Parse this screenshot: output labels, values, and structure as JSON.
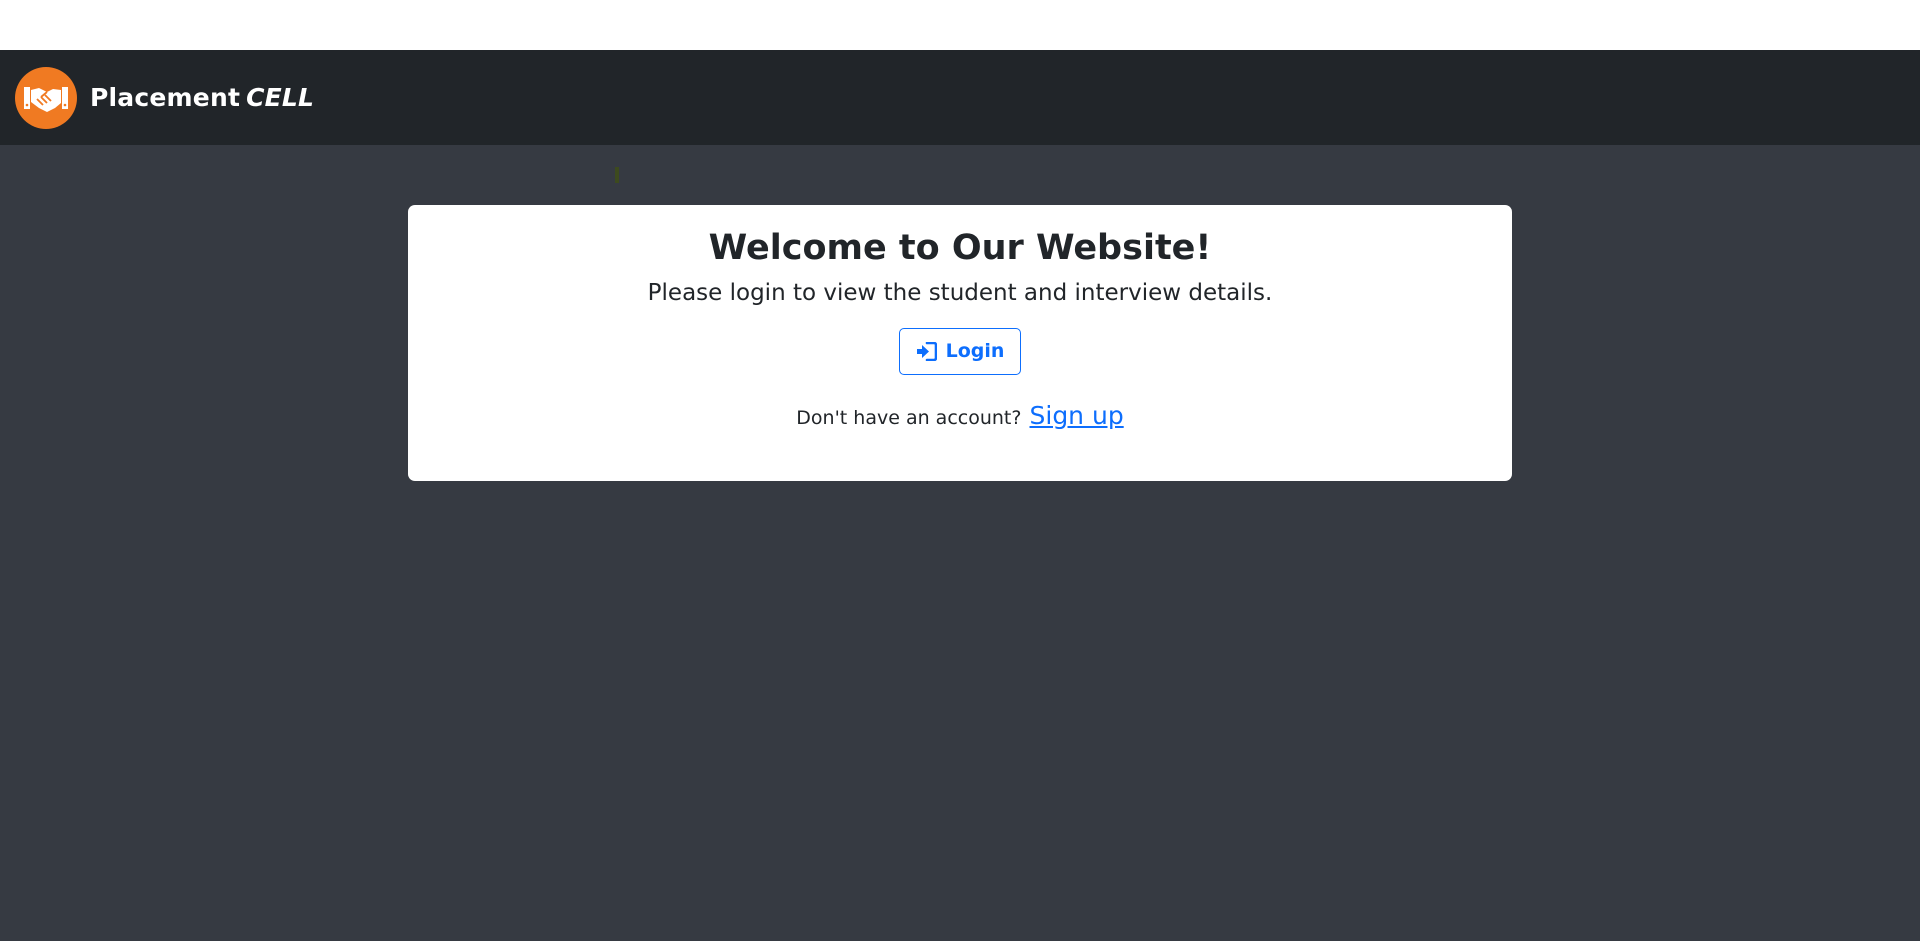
{
  "navbar": {
    "brand_name": "Placement",
    "brand_emphasis": "CELL",
    "logo_icon": "handshake-icon",
    "bg_color": "#212529",
    "logo_color": "#f07a22"
  },
  "card": {
    "title": "Welcome to Our Website!",
    "subtitle": "Please login to view the student and interview details.",
    "login_label": "Login",
    "login_icon": "sign-in-icon",
    "signup_prompt": "Don't have an account?",
    "signup_label": "Sign up"
  },
  "colors": {
    "page_bg": "#363a42",
    "primary": "#0d6efd",
    "text": "#212529"
  }
}
